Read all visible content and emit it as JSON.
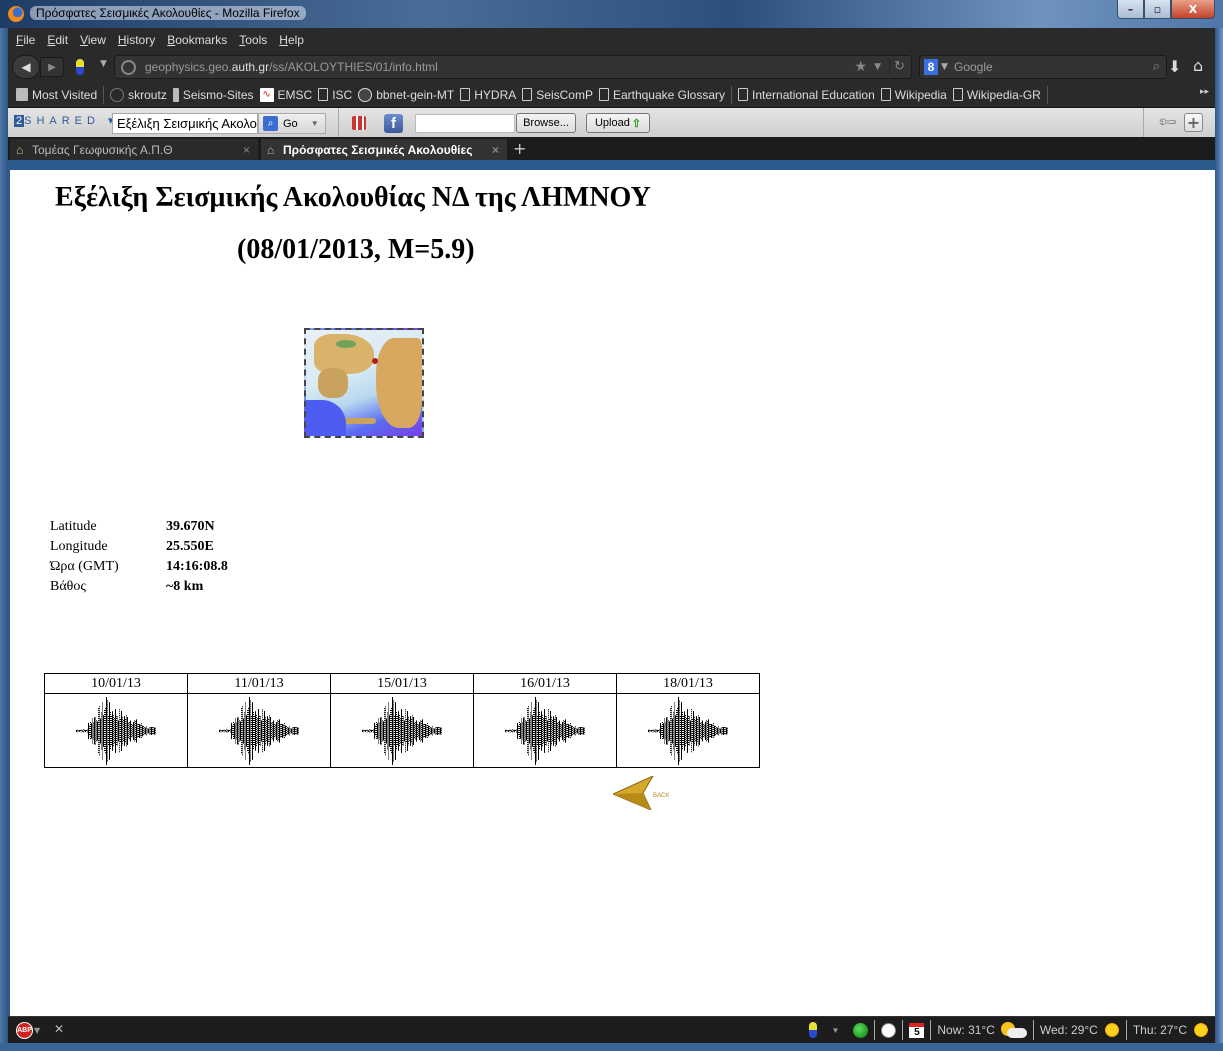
{
  "window": {
    "title": "Πρόσφατες Σεισμικές Ακολουθίες - Mozilla Firefox",
    "buttons": {
      "minimize": "–",
      "maximize": "▫",
      "close": "X"
    }
  },
  "menu": [
    "File",
    "Edit",
    "View",
    "History",
    "Bookmarks",
    "Tools",
    "Help"
  ],
  "nav": {
    "url_prefix": "geophysics.geo.",
    "url_domain": "auth.gr",
    "url_suffix": "/ss/AKOLOYTHIES/01/info.html",
    "search_placeholder": "Google",
    "search_engine": "8"
  },
  "bookmarks": [
    {
      "label": "Most Visited",
      "icon": "most-visited-icon"
    },
    {
      "label": "skroutz",
      "icon": "skroutz-icon"
    },
    {
      "label": "Seismo-Sites",
      "icon": "folder-icon"
    },
    {
      "label": "EMSC",
      "icon": "emsc-icon"
    },
    {
      "label": "ISC",
      "icon": "page-icon"
    },
    {
      "label": "bbnet-gein-MT",
      "icon": "globe-icon"
    },
    {
      "label": "HYDRA",
      "icon": "page-icon"
    },
    {
      "label": "SeisComP",
      "icon": "page-icon"
    },
    {
      "label": "Earthquake Glossary",
      "icon": "page-icon"
    },
    {
      "label": "International Education",
      "icon": "page-icon"
    },
    {
      "label": "Wikipedia",
      "icon": "page-icon"
    },
    {
      "label": "Wikipedia-GR",
      "icon": "page-icon"
    }
  ],
  "addon_toolbar": {
    "brand_two": "2",
    "brand_rest": "SHARED",
    "search_value": "Εξέλιξη Σεισμικής Ακολουθίας",
    "go_label": "Go",
    "browse_label": "Browse...",
    "upload_label": "Upload",
    "facebook_glyph": "f"
  },
  "tabs": [
    {
      "label": "Τομέας Γεωφυσικής Α.Π.Θ",
      "active": false
    },
    {
      "label": "Πρόσφατες Σεισμικές Ακολουθίες",
      "active": true
    }
  ],
  "page": {
    "title": "Εξέλιξη Σεισμικής Ακολουθίας ΝΔ της ΛΗΜΝΟΥ",
    "subtitle": "(08/01/2013, M=5.9)",
    "info": [
      {
        "label": "Latitude",
        "value": "39.670N"
      },
      {
        "label": "Longitude",
        "value": "25.550E"
      },
      {
        "label": "Ώρα (GMT)",
        "value": "14:16:08.8"
      },
      {
        "label": "Βάθος",
        "value": "~8 km"
      }
    ],
    "sequence_dates": [
      "10/01/13",
      "11/01/13",
      "15/01/13",
      "16/01/13",
      "18/01/13"
    ],
    "back_label": "BACK"
  },
  "statusbar": {
    "abp_label": "ABP",
    "calendar_day": "5",
    "weather": [
      {
        "label": "Now: 31°C",
        "icon": "partly-cloudy-icon"
      },
      {
        "label": "Wed: 29°C",
        "icon": "sun-icon"
      },
      {
        "label": "Thu: 27°C",
        "icon": "sun-icon"
      }
    ]
  }
}
